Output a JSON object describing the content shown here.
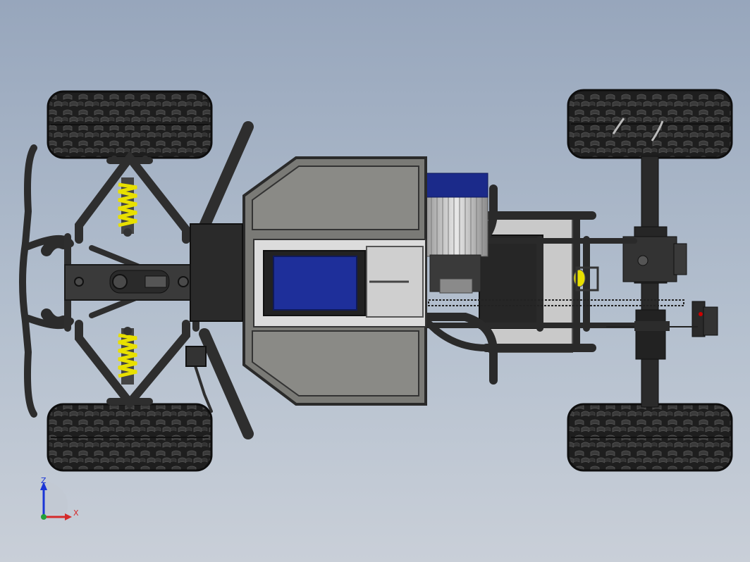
{
  "view": {
    "triad": {
      "z_label": "Z",
      "x_label": "X",
      "z_color": "#1a35d6",
      "x_color": "#d42a2a",
      "y_color": "#22a03a"
    }
  },
  "colors": {
    "background_top": "#97a6bc",
    "background_bottom": "#c9cfd8",
    "frame_tube": "#2f2f2f",
    "tire": "#1c1c1c",
    "spring": "#e8e000",
    "panel": "#7a7a76",
    "battery": "#1e2f9a",
    "motor_cap": "#1b2a8a"
  }
}
